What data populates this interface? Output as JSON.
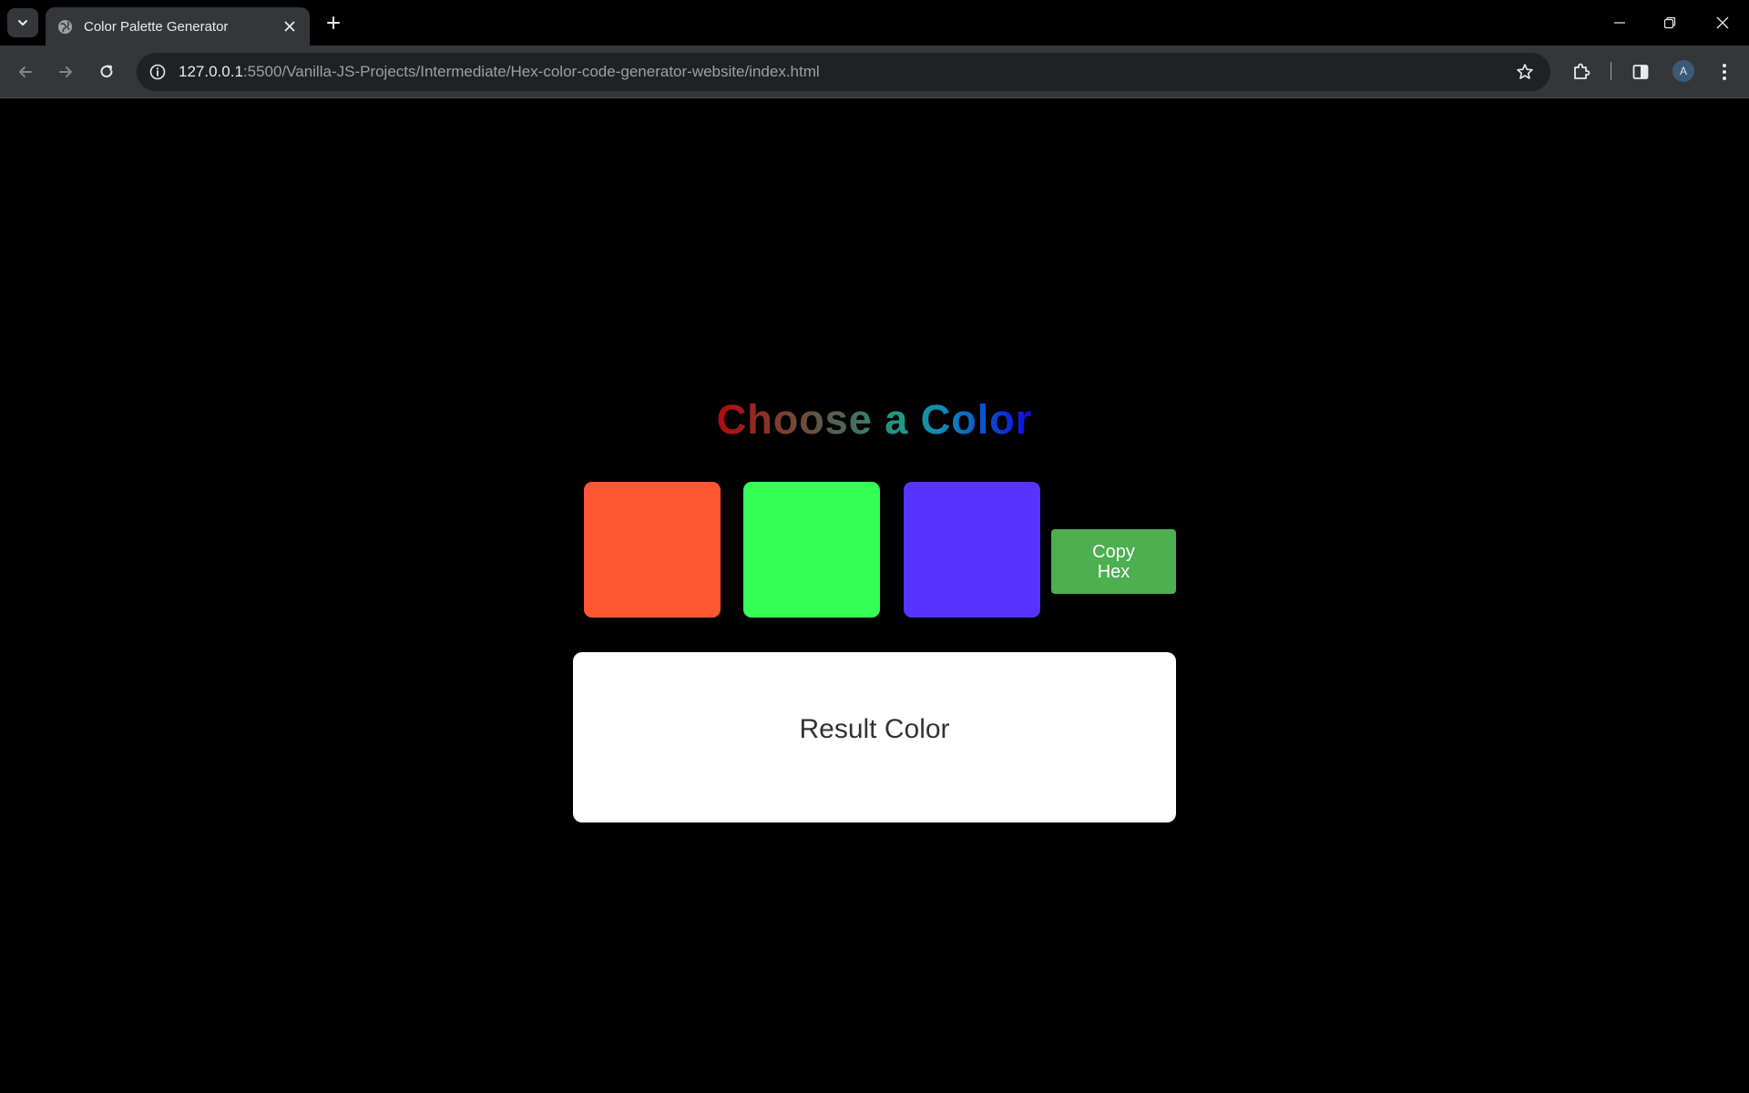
{
  "browser": {
    "tab": {
      "title": "Color Palette Generator",
      "favicon": "globe-icon"
    },
    "address_bar": {
      "url_host": "127.0.0.1",
      "url_rest": ":5500/Vanilla-JS-Projects/Intermediate/Hex-color-code-generator-website/index.html"
    },
    "profile_initial": "A",
    "icons": {
      "tab_search": "chevron-down-icon",
      "new_tab": "plus-icon",
      "minimize": "minimize-icon",
      "restore": "restore-icon",
      "close": "close-icon",
      "back": "back-arrow-icon",
      "forward": "forward-arrow-icon",
      "reload": "reload-icon",
      "site_info": "info-icon",
      "bookmark": "star-icon",
      "extensions": "puzzle-icon",
      "side_panel": "side-panel-icon",
      "menu": "kebab-menu-icon"
    }
  },
  "page": {
    "heading": "Choose a Color",
    "swatches": [
      {
        "color": "#ff5733"
      },
      {
        "color": "#33ff57"
      },
      {
        "color": "#5733ff"
      }
    ],
    "copy_button_label": "Copy Hex",
    "result_label": "Result Color",
    "colors": {
      "background": "#000000",
      "button": "#4caf50",
      "result_box": "#ffffff"
    }
  }
}
